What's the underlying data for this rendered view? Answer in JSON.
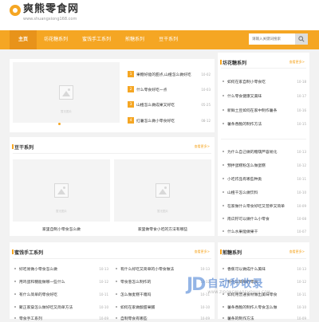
{
  "header": {
    "logo_title": "爽熊零食网",
    "logo_sub": "www.shuangxiong168.com"
  },
  "nav": {
    "items": [
      "主页",
      "坊花糖系列",
      "蜜饯手工系列",
      "煎糖系列",
      "豆干系列"
    ],
    "search_placeholder": "请输入关键词搜索"
  },
  "featured": {
    "image_caption": "暂无图片",
    "items": [
      {
        "num": "1",
        "title": "果糖好能的甜点,山楂怎么做好吃",
        "date": "10-02"
      },
      {
        "num": "2",
        "title": "什么零食好吃一点",
        "date": "10-03"
      },
      {
        "num": "3",
        "title": "山楂怎么做成果又好吃",
        "date": "05-25"
      },
      {
        "num": "4",
        "title": "红薯怎么做小零食好吃",
        "date": "08-12"
      }
    ]
  },
  "sidebar1": {
    "title": "坊花糖系列",
    "more": "查看更多>",
    "items": [
      {
        "text": "如何在家自制小零食吃",
        "date": "10-18"
      },
      {
        "text": "什么零食健康又美味",
        "date": "10-17"
      },
      {
        "text": "新鲜土豆如何在家中制作薯条",
        "date": "10-16"
      },
      {
        "text": "薯条香脆的制作方法",
        "date": "10-15"
      }
    ]
  },
  "sidebar2": {
    "items": [
      {
        "text": "为什么自己做的糖葫芦容易化",
        "date": "10-13"
      },
      {
        "text": "预拌蛋糕粉怎么做蛋糕",
        "date": "10-12"
      },
      {
        "text": "小吃炸品有哪些种类",
        "date": "10-11"
      },
      {
        "text": "山楂干怎么做饮料",
        "date": "10-10"
      },
      {
        "text": "在家做什么零食好吃又营养又简单",
        "date": "10-09"
      },
      {
        "text": "南瓜籽可以做什么小零食",
        "date": "10-08"
      },
      {
        "text": "什么水果能做果干",
        "date": "10-07"
      }
    ]
  },
  "tofu": {
    "title": "豆干系列",
    "more": "查看更多>",
    "image_caption": "暂无图片",
    "captions": [
      "家里自制小零食怎么做",
      "家里做零食小吃的方法有哪些"
    ]
  },
  "candied": {
    "title": "蜜饯手工系列",
    "more": "查看更多>",
    "items_left": [
      {
        "text": "好吃易做小零食怎么做",
        "date": "10-13"
      },
      {
        "text": "用鸡蛋和糖能做哪一些什么",
        "date": "10-12"
      },
      {
        "text": "有什么简单的零食好吃",
        "date": "10-11"
      },
      {
        "text": "聚正家穿怎么做好吃又简单方法",
        "date": "10-10"
      },
      {
        "text": "零食手工系列",
        "date": "10-09"
      }
    ],
    "items_right": [
      {
        "text": "有什么好吃又简单的小零食做法",
        "date": "10-13"
      },
      {
        "text": "零食葱怎么制作的",
        "date": "10-12"
      },
      {
        "text": "怎么做麦糕干嘎吗",
        "date": "10-11"
      },
      {
        "text": "如何在家做酸甜果脯",
        "date": "10-10"
      },
      {
        "text": "自制零食有哪些",
        "date": "10-09"
      }
    ]
  },
  "sugar": {
    "title": "煎糖系列",
    "more": "查看更多>",
    "items": [
      {
        "text": "香蕉可以做成什么美味",
        "date": "10-13"
      },
      {
        "text": "有什么简单的零食",
        "date": "10-12"
      },
      {
        "text": "如何用普通食材做出美味零食",
        "date": "10-11"
      },
      {
        "text": "薯条香脆的制作人零食怎么做",
        "date": "10-10"
      },
      {
        "text": "薯条的制作方法",
        "date": "10-09"
      }
    ]
  },
  "watermark": {
    "logo": "JD",
    "title": "自动秒收录",
    "sub": "WWW.ZIDONGMIAOSHOULU.COM"
  },
  "colors": {
    "accent": "#f5a623"
  }
}
